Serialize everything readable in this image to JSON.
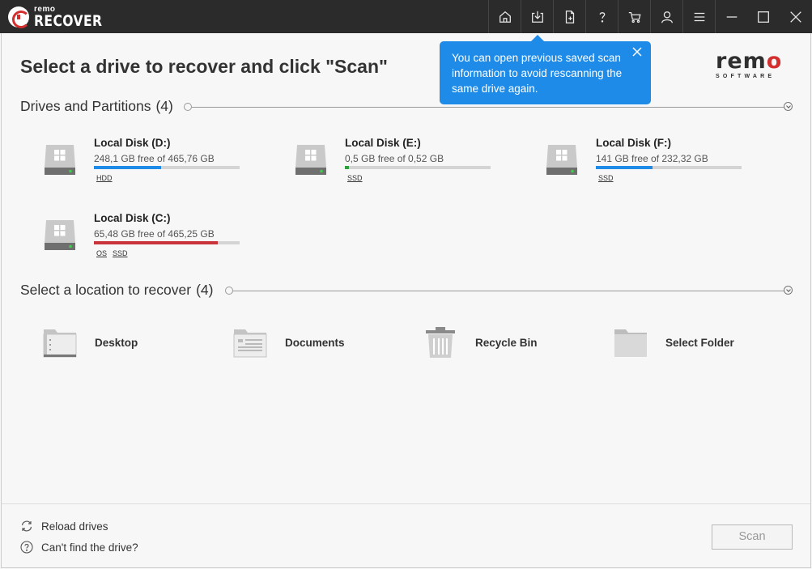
{
  "app": {
    "logo_small": "remo",
    "logo_big": "RECOVER"
  },
  "toolbar": {
    "icons": [
      "home-icon",
      "open-scan-icon",
      "export-icon",
      "help-icon",
      "cart-icon",
      "user-icon",
      "menu-icon",
      "minimize-icon",
      "maximize-icon",
      "close-icon"
    ]
  },
  "page": {
    "title": "Select a drive to recover and click \"Scan\""
  },
  "brand": {
    "word": "remo",
    "sub": "SOFTWARE",
    "accent": "#d32f2f"
  },
  "tooltip": {
    "text": "You can open previous saved scan information to avoid rescanning the same drive again.",
    "color": "#1e8be8"
  },
  "drives_section": {
    "title": "Drives and Partitions",
    "count": "(4)",
    "drives": [
      {
        "name": "Local Disk (D:)",
        "free": "248,1 GB free of 465,76 GB",
        "used_fraction": 0.46,
        "bar_color": "#1e8be8",
        "tags": [
          "HDD"
        ]
      },
      {
        "name": "Local Disk (E:)",
        "free": "0,5 GB free of 0,52 GB",
        "used_fraction": 0.03,
        "bar_color": "#2e9e3e",
        "tags": [
          "SSD"
        ]
      },
      {
        "name": "Local Disk (F:)",
        "free": "141 GB free of 232,32 GB",
        "used_fraction": 0.39,
        "bar_color": "#1e8be8",
        "tags": [
          "SSD"
        ]
      },
      {
        "name": "Local Disk (C:)",
        "free": "65,48 GB free of 465,25 GB",
        "used_fraction": 0.85,
        "bar_color": "#c8343a",
        "tags": [
          "OS",
          "SSD"
        ]
      }
    ]
  },
  "locations_section": {
    "title": "Select a location to recover",
    "count": "(4)",
    "locations": [
      {
        "label": "Desktop",
        "icon": "desktop-folder-icon"
      },
      {
        "label": "Documents",
        "icon": "documents-folder-icon"
      },
      {
        "label": "Recycle Bin",
        "icon": "recycle-bin-icon"
      },
      {
        "label": "Select Folder",
        "icon": "folder-icon"
      }
    ]
  },
  "footer": {
    "reload": "Reload drives",
    "cant_find": "Can't find the drive?",
    "scan": "Scan"
  }
}
